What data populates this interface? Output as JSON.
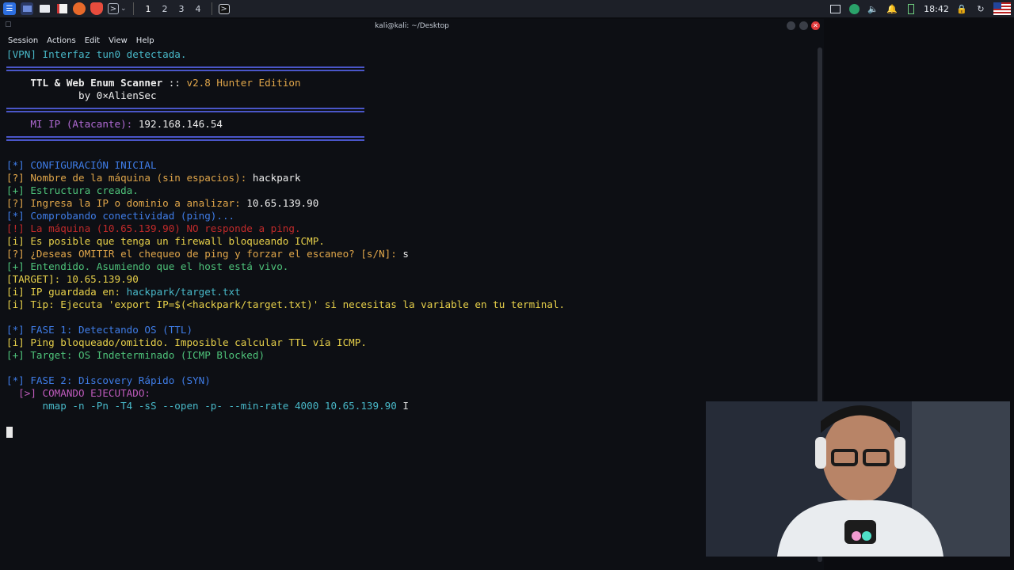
{
  "panel": {
    "workspaces": [
      "1",
      "2",
      "3",
      "4"
    ],
    "clock": "18:42"
  },
  "window": {
    "title": "kali@kali: ~/Desktop",
    "menu": [
      "Session",
      "Actions",
      "Edit",
      "View",
      "Help"
    ]
  },
  "terminal": {
    "vpn_line": "[VPN] Interfaz tun0 detectada.",
    "banner_title": "TTL & Web Enum Scanner",
    "banner_sep": " :: ",
    "banner_version": "v2.8 Hunter Edition",
    "banner_author": "by 0×AlienSec",
    "ip_label": "MI IP (Atacante):",
    "ip_value": "192.168.146.54",
    "lines": [
      {
        "tag": "[*]",
        "text": " CONFIGURACIÓN INICIAL"
      },
      {
        "tag": "[?]",
        "text": " Nombre de la máquina (sin espacios):",
        "value": " hackpark"
      },
      {
        "tag": "[+]",
        "text": " Estructura creada."
      },
      {
        "tag": "[?]",
        "text": " Ingresa la IP o dominio a analizar:",
        "value": " 10.65.139.90"
      },
      {
        "tag": "[*]",
        "text": " Comprobando conectividad (ping)..."
      },
      {
        "tag": "[!]",
        "text": " La máquina (10.65.139.90) NO responde a ping."
      },
      {
        "tag": "[i]",
        "text": " Es posible que tenga un firewall bloqueando ICMP."
      },
      {
        "tag": "[?]",
        "text": " ¿Deseas OMITIR el chequeo de ping y forzar el escaneo? [s/N]:",
        "value": " s"
      },
      {
        "tag": "[+]",
        "text": " Entendido. Asumiendo que el host está vivo."
      },
      {
        "tag": "[TARGET]:",
        "text": " 10.65.139.90"
      },
      {
        "tag": "[i]",
        "text": " IP guardada en:",
        "value": " hackpark/target.txt"
      },
      {
        "tag": "[i]",
        "text": " Tip: Ejecuta 'export IP=$(<hackpark/target.txt)' si necesitas la variable en tu terminal."
      },
      {
        "tag": "[*]",
        "text": " FASE 1: Detectando OS (TTL)"
      },
      {
        "tag": "[i]",
        "text": " Ping bloqueado/omitido. Imposible calcular TTL vía ICMP."
      },
      {
        "tag": "[+]",
        "text": " Target: OS Indeterminado (ICMP Blocked)"
      },
      {
        "tag": "[*]",
        "text": " FASE 2: Discovery Rápido (SYN)"
      },
      {
        "tag": "[>]",
        "text": " COMANDO EJECUTADO:"
      },
      {
        "tag": "",
        "text": "nmap -n -Pn -T4 -sS --open -p- --min-rate 4000 10.65.139.90"
      }
    ]
  },
  "colors": {
    "accent_blue": "#3f7de8",
    "separator": "#4a56c9",
    "error_red": "#c22a2a",
    "value_white": "#ececec"
  }
}
